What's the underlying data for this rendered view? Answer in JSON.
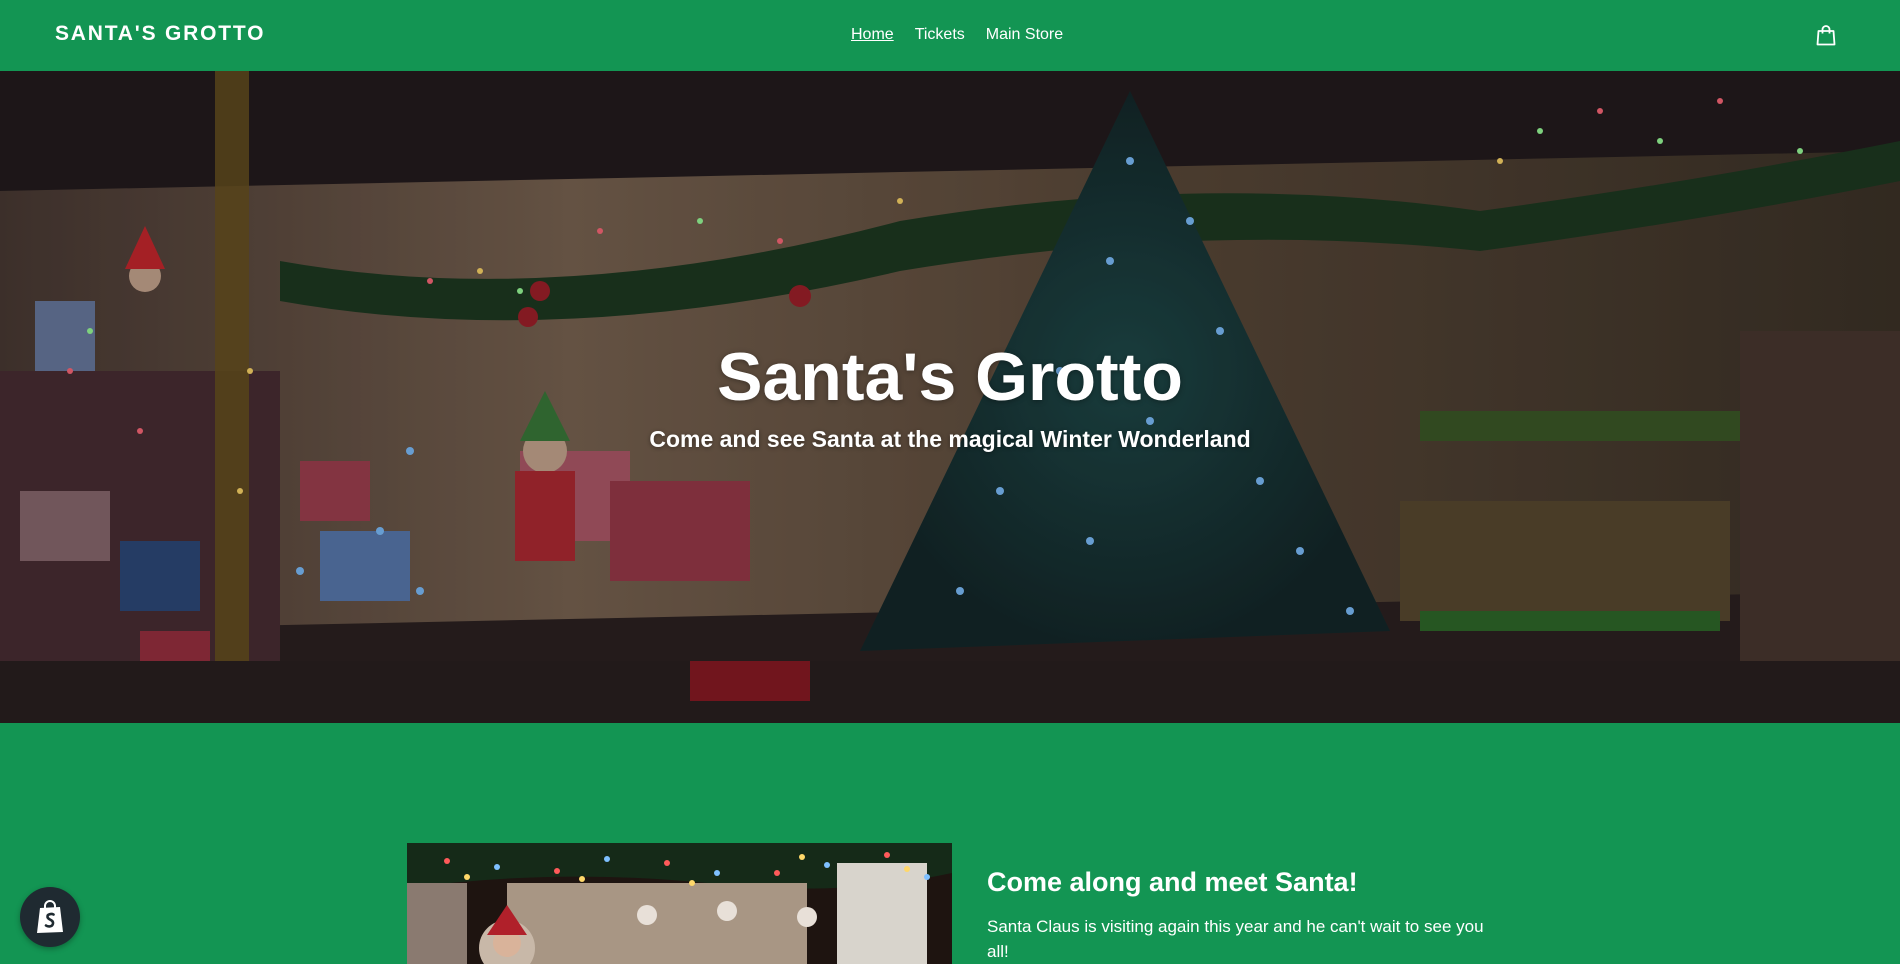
{
  "header": {
    "logo": "SANTA'S GROTTO",
    "nav": [
      {
        "label": "Home",
        "active": true
      },
      {
        "label": "Tickets",
        "active": false
      },
      {
        "label": "Main Store",
        "active": false
      }
    ],
    "cart_icon": "shopping-bag-icon"
  },
  "hero": {
    "title": "Santa's Grotto",
    "subtitle": "Come and see Santa at the magical Winter Wonderland"
  },
  "feature": {
    "heading": "Come along and meet Santa!",
    "body": "Santa Claus is visiting again this year and he can't wait to see you all!"
  },
  "badge": {
    "icon": "shopify-bag-icon"
  },
  "colors": {
    "brand_green": "#139553",
    "badge_dark": "#1f2a31",
    "text": "#ffffff"
  }
}
